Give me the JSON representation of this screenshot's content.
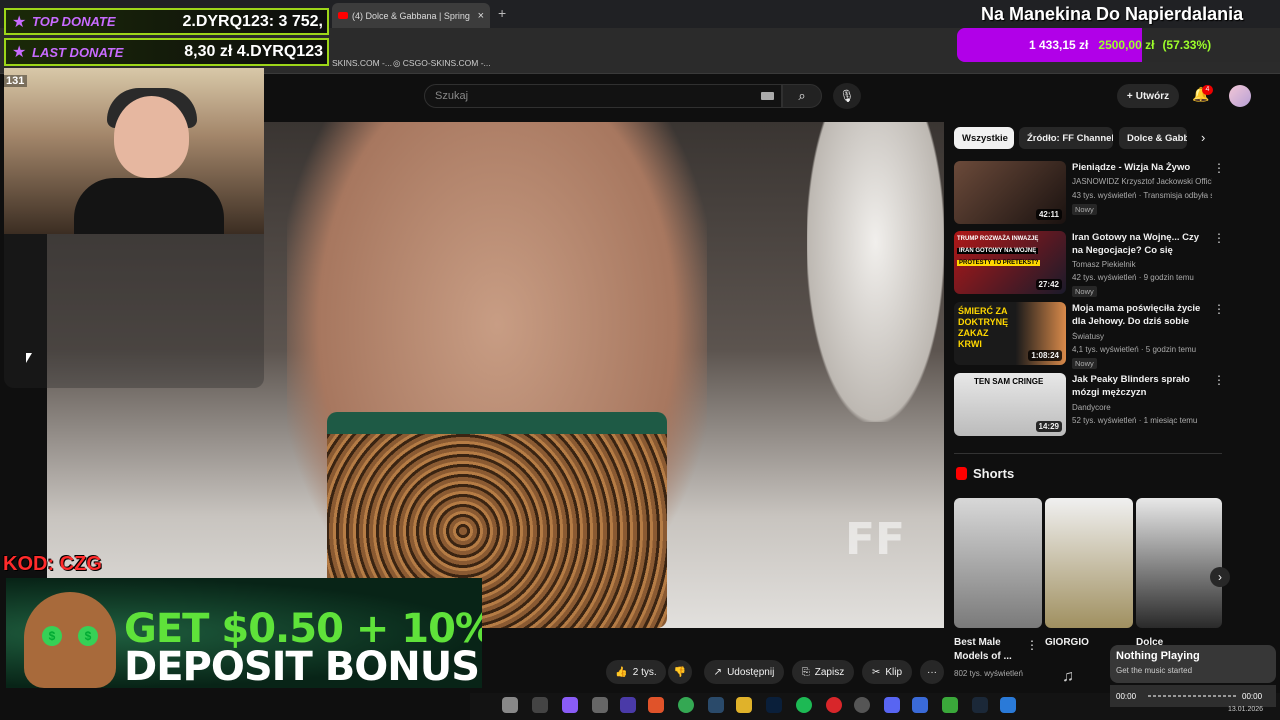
{
  "browser": {
    "tab_title": "(4) Dolce & Gabbana | Spring",
    "tab_close": "×",
    "new_tab": "+",
    "bookmarks": [
      "SKINS.COM -...",
      "CSGO-SKINS.COM -..."
    ]
  },
  "youtube": {
    "search_placeholder": "Szukaj",
    "create_label": "Utwórz",
    "notification_count": "4",
    "actions": {
      "like": "2 tys.",
      "share": "Udostępnij",
      "save": "Zapisz",
      "clip": "Klip",
      "more": "···"
    },
    "chips": [
      "Wszystkie",
      "Źródło: FF Channel",
      "Dolce & Gabbana"
    ],
    "recommendations": [
      {
        "title": "Pieniądze - Wizja Na Żywo",
        "channel": "JASNOWIDZ Krzysztof Jackowski Official",
        "meta": "43 tys. wyświetleń · Transmisja odbyła s...",
        "badge": "Nowy",
        "duration": "42:11"
      },
      {
        "title": "Iran Gotowy na Wojnę... Czy na Negocjacje? Co się Naprawdę ...",
        "channel": "Tomasz Piekielnik",
        "meta": "42 tys. wyświetleń · 9 godzin temu",
        "badge": "Nowy",
        "duration": "27:42"
      },
      {
        "title": "Moja mama poświęciła życie dla Jehowy. Do dziś sobie teg...",
        "channel": "Światusy",
        "meta": "4,1 tys. wyświetleń · 5 godzin temu",
        "badge": "Nowy",
        "duration": "1:08:24"
      },
      {
        "title": "Jak Peaky Blinders sprało mózgi mężczyzn",
        "channel": "Dandycore",
        "meta": "52 tys. wyświetleń · 1 miesiąc temu",
        "badge": "",
        "duration": "14:29"
      }
    ],
    "thumb_text": {
      "t2_top": "TRUMP ROZWAŻA INWAZJĘ",
      "t2_mid": "IRAN GOTOWY NA WOJNĘ",
      "t2_bot": "PROTESTY TO PRETEKST?",
      "t3": "ŚMIERĆ ZA DOKTRYNĘ ZAKAZ KRWI",
      "t4": "TEN SAM CRINGE"
    },
    "shorts_heading": "Shorts",
    "shorts": [
      {
        "title": "Best Male Models of ...",
        "meta": "802 tys. wyświetleń"
      },
      {
        "title": "GIORGIO",
        "meta": ""
      },
      {
        "title": "Dolce",
        "meta": ""
      }
    ],
    "video_watermark": "FF"
  },
  "overlay": {
    "top_donate_label": "TOP DONATE",
    "top_donate_value": "2.DYRQ123: 3 752,",
    "last_donate_label": "LAST DONATE",
    "last_donate_value": "8,30 zł 4.DYRQ123",
    "viewer_count": "131",
    "code": "KOD: CZG",
    "banner_line1_a": "GET ",
    "banner_line1_b": "$0.50 + 10%",
    "banner_line2": "DEPOSIT BONUS",
    "stream_title": "Na Manekina Do Napierdalania",
    "goal_current": "1 433,15 zł",
    "goal_target": "2500,00 zł",
    "goal_percent": "(57.33%)",
    "goal_fraction": 0.5733,
    "now_playing_title": "Nothing Playing",
    "now_playing_sub": "Get the music started",
    "np_time_start": "00:00",
    "np_time_end": "00:00",
    "clock": "13.01.2026"
  },
  "colors": {
    "accent_green": "#9dd619",
    "goal_purple": "#b100e8",
    "youtube_red": "#ff0000"
  }
}
